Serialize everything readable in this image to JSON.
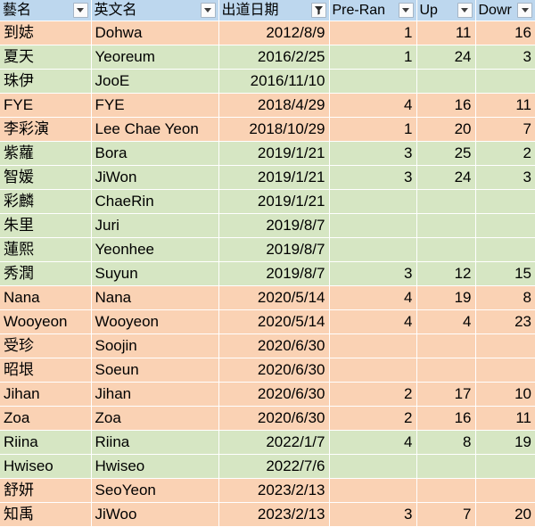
{
  "table": {
    "columns": [
      {
        "key": "stage_name",
        "label": "藝名",
        "filter_icon": "chevron-down-icon",
        "align": "left"
      },
      {
        "key": "english_name",
        "label": "英文名",
        "filter_icon": "chevron-down-icon",
        "align": "left"
      },
      {
        "key": "debut_date",
        "label": "出道日期",
        "filter_icon": "funnel-filter-icon",
        "align": "right"
      },
      {
        "key": "pre_rank",
        "label": "Pre-Ran",
        "filter_icon": "chevron-down-icon",
        "align": "right"
      },
      {
        "key": "up",
        "label": "Up",
        "filter_icon": "chevron-down-icon",
        "align": "right"
      },
      {
        "key": "down",
        "label": "Dowr",
        "filter_icon": "chevron-down-icon",
        "align": "right"
      }
    ],
    "rows": [
      {
        "stage_name": "到娡",
        "english_name": "Dohwa",
        "debut_date": "2012/8/9",
        "pre_rank": "1",
        "up": "11",
        "down": "16",
        "band": "a"
      },
      {
        "stage_name": "夏天",
        "english_name": "Yeoreum",
        "debut_date": "2016/2/25",
        "pre_rank": "1",
        "up": "24",
        "down": "3",
        "band": "b"
      },
      {
        "stage_name": "珠伊",
        "english_name": "JooE",
        "debut_date": "2016/11/10",
        "pre_rank": "",
        "up": "",
        "down": "",
        "band": "b"
      },
      {
        "stage_name": "FYE",
        "english_name": "FYE",
        "debut_date": "2018/4/29",
        "pre_rank": "4",
        "up": "16",
        "down": "11",
        "band": "a"
      },
      {
        "stage_name": "李彩演",
        "english_name": "Lee Chae Yeon",
        "debut_date": "2018/10/29",
        "pre_rank": "1",
        "up": "20",
        "down": "7",
        "band": "a"
      },
      {
        "stage_name": "紫蘿",
        "english_name": "Bora",
        "debut_date": "2019/1/21",
        "pre_rank": "3",
        "up": "25",
        "down": "2",
        "band": "b"
      },
      {
        "stage_name": "智媛",
        "english_name": "JiWon",
        "debut_date": "2019/1/21",
        "pre_rank": "3",
        "up": "24",
        "down": "3",
        "band": "b"
      },
      {
        "stage_name": "彩麟",
        "english_name": "ChaeRin",
        "debut_date": "2019/1/21",
        "pre_rank": "",
        "up": "",
        "down": "",
        "band": "b"
      },
      {
        "stage_name": "朱里",
        "english_name": "Juri",
        "debut_date": "2019/8/7",
        "pre_rank": "",
        "up": "",
        "down": "",
        "band": "b"
      },
      {
        "stage_name": "蓮熙",
        "english_name": "Yeonhee",
        "debut_date": "2019/8/7",
        "pre_rank": "",
        "up": "",
        "down": "",
        "band": "b"
      },
      {
        "stage_name": "秀潤",
        "english_name": "Suyun",
        "debut_date": "2019/8/7",
        "pre_rank": "3",
        "up": "12",
        "down": "15",
        "band": "b"
      },
      {
        "stage_name": "Nana",
        "english_name": "Nana",
        "debut_date": "2020/5/14",
        "pre_rank": "4",
        "up": "19",
        "down": "8",
        "band": "a"
      },
      {
        "stage_name": "Wooyeon",
        "english_name": "Wooyeon",
        "debut_date": "2020/5/14",
        "pre_rank": "4",
        "up": "4",
        "down": "23",
        "band": "a"
      },
      {
        "stage_name": "受珍",
        "english_name": "Soojin",
        "debut_date": "2020/6/30",
        "pre_rank": "",
        "up": "",
        "down": "",
        "band": "a"
      },
      {
        "stage_name": "昭垠",
        "english_name": "Soeun",
        "debut_date": "2020/6/30",
        "pre_rank": "",
        "up": "",
        "down": "",
        "band": "a"
      },
      {
        "stage_name": "Jihan",
        "english_name": "Jihan",
        "debut_date": "2020/6/30",
        "pre_rank": "2",
        "up": "17",
        "down": "10",
        "band": "a"
      },
      {
        "stage_name": "Zoa",
        "english_name": "Zoa",
        "debut_date": "2020/6/30",
        "pre_rank": "2",
        "up": "16",
        "down": "11",
        "band": "a"
      },
      {
        "stage_name": "Riina",
        "english_name": "Riina",
        "debut_date": "2022/1/7",
        "pre_rank": "4",
        "up": "8",
        "down": "19",
        "band": "b"
      },
      {
        "stage_name": "Hwiseo",
        "english_name": "Hwiseo",
        "debut_date": "2022/7/6",
        "pre_rank": "",
        "up": "",
        "down": "",
        "band": "b"
      },
      {
        "stage_name": "舒妍",
        "english_name": "SeoYeon",
        "debut_date": "2023/2/13",
        "pre_rank": "",
        "up": "",
        "down": "",
        "band": "a"
      },
      {
        "stage_name": "知禹",
        "english_name": "JiWoo",
        "debut_date": "2023/2/13",
        "pre_rank": "3",
        "up": "7",
        "down": "20",
        "band": "a"
      }
    ]
  },
  "colors": {
    "header_fill": "#BDD7EE",
    "band_a_fill": "#FAD2B4",
    "band_b_fill": "#D6E6C3",
    "gridline": "#FFFFFF",
    "text": "#000000"
  }
}
